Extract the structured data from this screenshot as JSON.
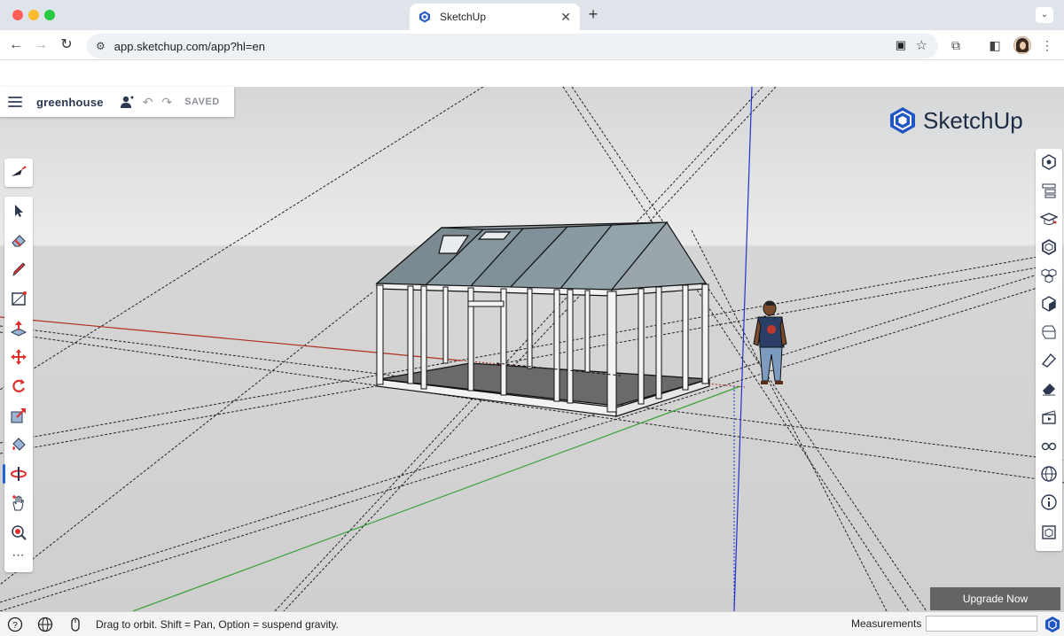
{
  "browser": {
    "tab_title": "SketchUp",
    "url": "app.sketchup.com/app?hl=en",
    "icons": [
      "back-icon",
      "forward-icon",
      "reload-icon",
      "site-settings-icon",
      "install-app-icon",
      "bookmark-star-icon",
      "extensions-icon",
      "side-panel-icon",
      "profile-avatar",
      "menu-icon"
    ]
  },
  "file": {
    "name": "greenhouse",
    "status": "SAVED"
  },
  "logo": {
    "text": "SketchUp",
    "color": "#1d2b44"
  },
  "left_toolbar": {
    "tools": [
      "select-tool",
      "eraser-tool",
      "pencil-tool",
      "rectangle-tool",
      "push-pull-tool",
      "move-tool",
      "rotate-tool",
      "scale-tool",
      "paint-bucket-tool",
      "orbit-tool",
      "pan-tool",
      "zoom-tool"
    ],
    "active": "orbit-tool",
    "more": "⋯"
  },
  "right_toolbar": {
    "panels": [
      "entity-info-icon",
      "outliner-icon",
      "instructor-icon",
      "components-icon",
      "materials-icon",
      "styles-icon",
      "tags-icon",
      "scenes-icon",
      "soften-icon",
      "display-icon",
      "shadows-icon",
      "views-icon",
      "info-icon",
      "model-info-icon"
    ]
  },
  "upgrade_label": "Upgrade Now",
  "status_bar": {
    "hint": "Drag to orbit. Shift = Pan, Option = suspend gravity.",
    "measurements_label": "Measurements",
    "measurements_value": ""
  },
  "colors": {
    "accent": "#2463d1",
    "tool_red": "#e0302b",
    "axis_red": "#c0392b",
    "axis_green": "#4caf50",
    "axis_blue": "#2233cc"
  }
}
